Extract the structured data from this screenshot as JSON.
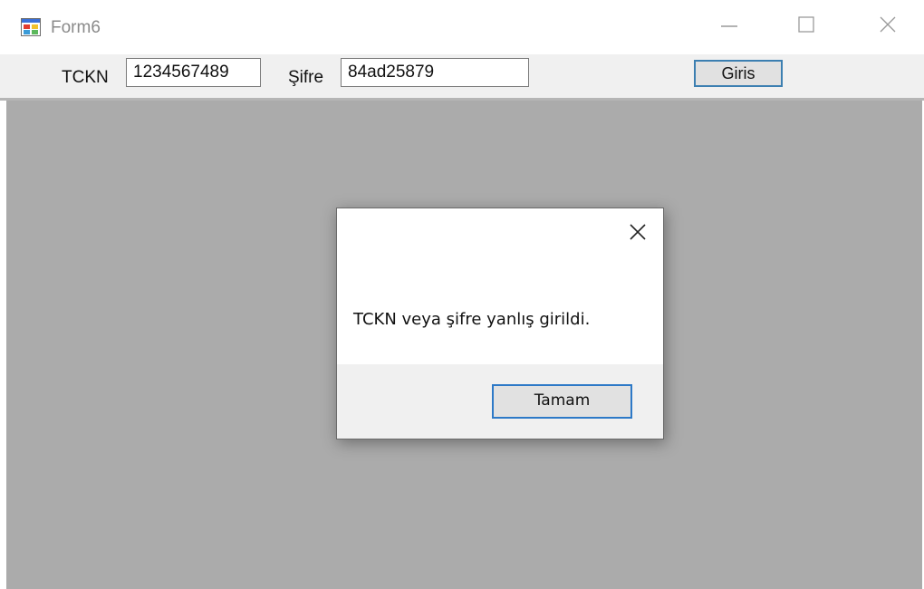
{
  "window": {
    "title": "Form6",
    "icons": {
      "app": "form-app-icon",
      "minimize": "minimize-icon",
      "maximize": "maximize-icon",
      "close": "close-icon"
    }
  },
  "toolbar": {
    "tckn_label": "TCKN",
    "tckn_value": "1234567489",
    "sifre_label": "Şifre",
    "sifre_value": "84ad25879",
    "giris_label": "Giris"
  },
  "dialog": {
    "message": "TCKN veya şifre yanlış girildi.",
    "ok_label": "Tamam",
    "close_icon": "close-icon"
  },
  "colors": {
    "client_background": "#ababab",
    "button_focus_border": "#2d79c7",
    "toolbar_background": "#f0f0f0"
  }
}
